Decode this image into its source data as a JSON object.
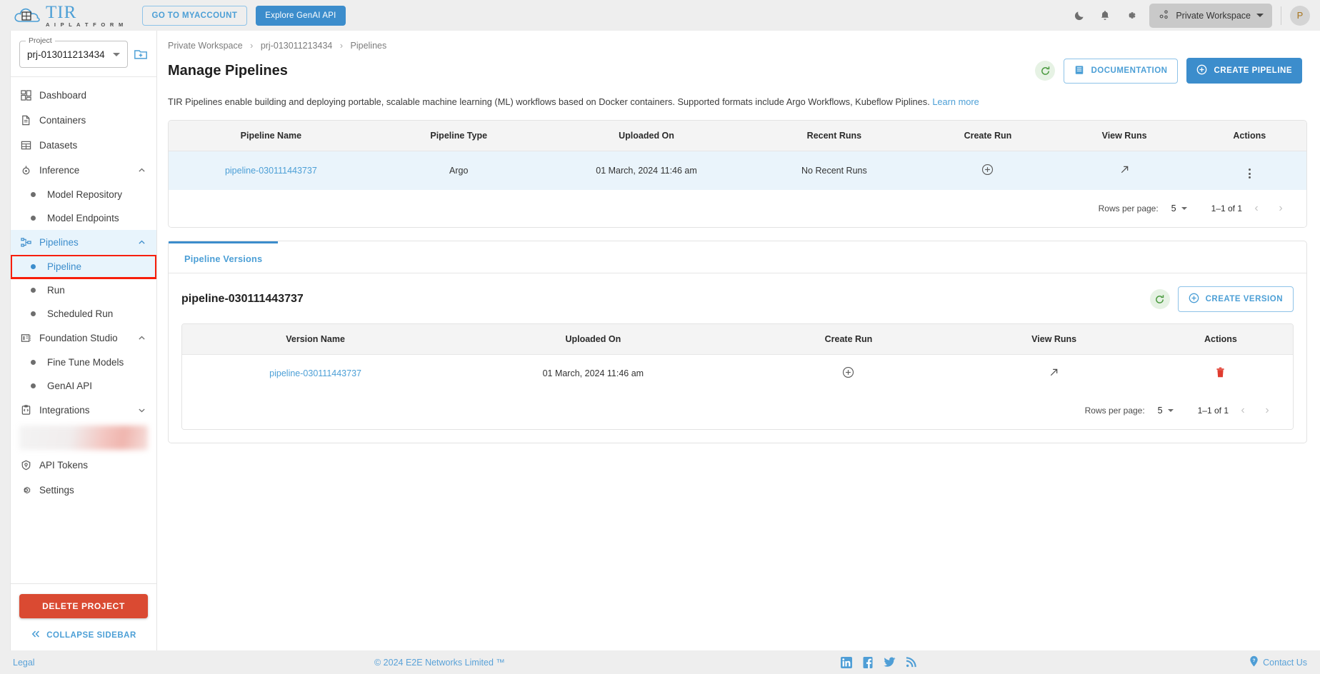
{
  "brand": {
    "logo_title": "TIR",
    "logo_subtitle": "A I   P L A T F O R M",
    "myaccount_label": "GO TO MYACCOUNT",
    "genai_label": "Explore GenAI API"
  },
  "topbar": {
    "icons": [
      "dark-mode-icon",
      "notifications-icon",
      "settings-icon"
    ],
    "workspace_label": "Private Workspace",
    "avatar_initial": "P"
  },
  "sidebar": {
    "project_legend": "Project",
    "project_value": "prj-013011213434",
    "items": [
      {
        "label": "Dashboard",
        "icon": "dashboard-icon",
        "type": "item"
      },
      {
        "label": "Containers",
        "icon": "containers-icon",
        "type": "item"
      },
      {
        "label": "Datasets",
        "icon": "datasets-icon",
        "type": "item"
      },
      {
        "label": "Inference",
        "icon": "inference-icon",
        "type": "item",
        "expanded": true
      },
      {
        "label": "Model Repository",
        "icon": "bullet-icon",
        "type": "sub"
      },
      {
        "label": "Model Endpoints",
        "icon": "bullet-icon",
        "type": "sub"
      },
      {
        "label": "Pipelines",
        "icon": "pipelines-icon",
        "type": "item",
        "expanded": true,
        "active": true
      },
      {
        "label": "Pipeline",
        "icon": "bullet-icon",
        "type": "sub",
        "active": true,
        "highlighted": true
      },
      {
        "label": "Run",
        "icon": "bullet-icon",
        "type": "sub"
      },
      {
        "label": "Scheduled Run",
        "icon": "bullet-icon",
        "type": "sub"
      },
      {
        "label": "Foundation Studio",
        "icon": "foundation-studio-icon",
        "type": "item",
        "expanded": true
      },
      {
        "label": "Fine Tune Models",
        "icon": "bullet-icon",
        "type": "sub"
      },
      {
        "label": "GenAI API",
        "icon": "bullet-icon",
        "type": "sub"
      },
      {
        "label": "Integrations",
        "icon": "integrations-icon",
        "type": "item",
        "expanded": false
      },
      {
        "label": "",
        "icon": "redacted-icon",
        "type": "blurred"
      },
      {
        "label": "API Tokens",
        "icon": "api-tokens-icon",
        "type": "item"
      },
      {
        "label": "Settings",
        "icon": "settings-gear-icon",
        "type": "item"
      }
    ],
    "delete_project_label": "DELETE PROJECT",
    "collapse_label": "COLLAPSE SIDEBAR"
  },
  "main": {
    "breadcrumb": [
      "Private Workspace",
      "prj-013011213434",
      "Pipelines"
    ],
    "page_title": "Manage Pipelines",
    "documentation_label": "DOCUMENTATION",
    "create_pipeline_label": "CREATE PIPELINE",
    "intro_text": "TIR Pipelines enable building and deploying portable, scalable machine learning (ML) workflows based on Docker containers. Supported formats include Argo Workflows, Kubeflow Piplines.",
    "learn_more_label": "Learn more"
  },
  "pipelines_table": {
    "columns": [
      "Pipeline Name",
      "Pipeline Type",
      "Uploaded On",
      "Recent Runs",
      "Create Run",
      "View Runs",
      "Actions"
    ],
    "rows": [
      {
        "name": "pipeline-030111443737",
        "type": "Argo",
        "uploaded_on": "01 March, 2024 11:46 am",
        "recent_runs": "No Recent Runs",
        "create_run": "plus-circle-icon",
        "view_runs": "arrow-up-right-icon",
        "actions": "kebab-menu-icon"
      }
    ],
    "pager": {
      "rows_per_page_label": "Rows per page:",
      "rows_per_page_value": "5",
      "range": "1–1 of 1",
      "prev": "chevron-left-icon",
      "next": "chevron-right-icon"
    }
  },
  "versions_panel": {
    "tab_label": "Pipeline Versions",
    "title": "pipeline-030111443737",
    "create_version_label": "CREATE VERSION",
    "columns": [
      "Version Name",
      "Uploaded On",
      "Create Run",
      "View Runs",
      "Actions"
    ],
    "rows": [
      {
        "name": "pipeline-030111443737",
        "uploaded_on": "01 March, 2024 11:46 am",
        "create_run": "plus-circle-icon",
        "view_runs": "arrow-up-right-icon",
        "actions": "delete-icon"
      }
    ],
    "pager": {
      "rows_per_page_label": "Rows per page:",
      "rows_per_page_value": "5",
      "range": "1–1 of 1",
      "prev": "chevron-left-icon",
      "next": "chevron-right-icon"
    }
  },
  "footer": {
    "legal": "Legal",
    "copyright": "© 2024 E2E Networks Limited ™",
    "socials": [
      "linkedin-icon",
      "facebook-icon",
      "twitter-icon",
      "rss-icon"
    ],
    "contact": "Contact Us"
  },
  "colors": {
    "accent": "#3c8dcc",
    "link": "#4c9fd6",
    "danger": "#da4a32",
    "highlight_outline": "#f71e0b",
    "row_highlight": "#eaf4fb"
  }
}
